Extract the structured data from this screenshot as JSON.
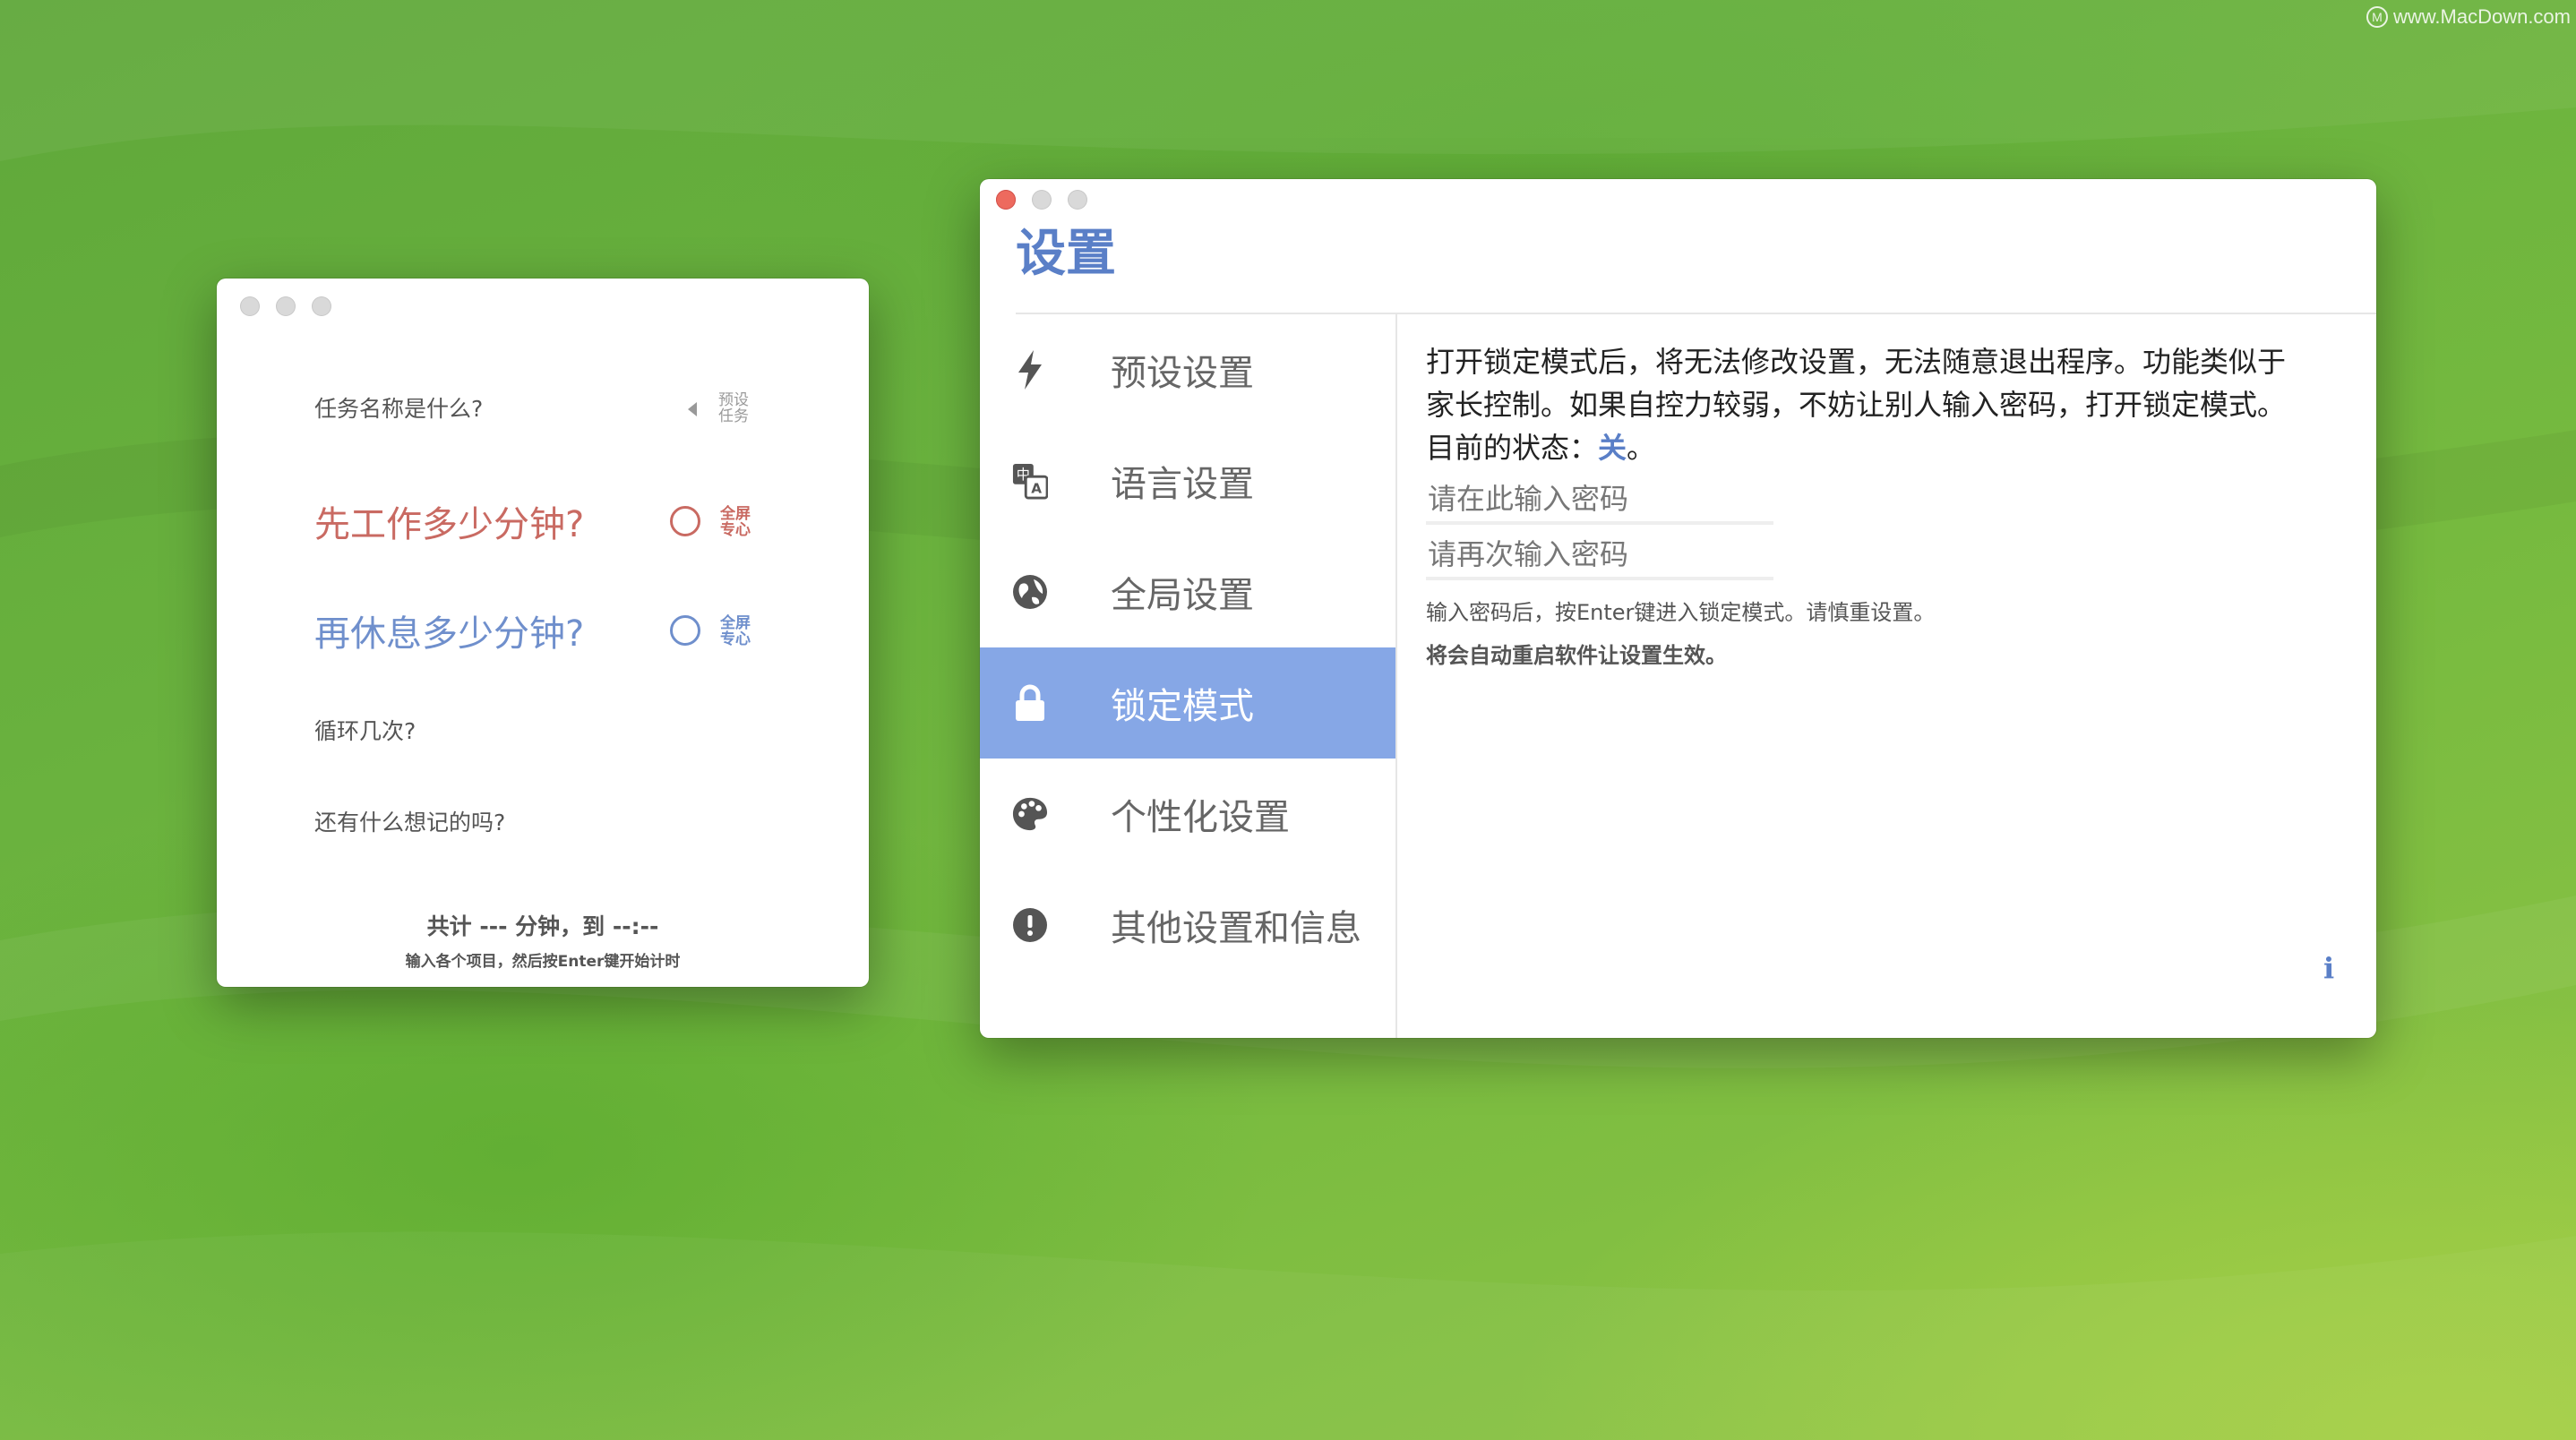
{
  "watermark": {
    "logo": "M",
    "text": "www.MacDown.com"
  },
  "timer_window": {
    "task_question": "任务名称是什么?",
    "preset_label_line1": "预设",
    "preset_label_line2": "任务",
    "work_question": "先工作多少分钟?",
    "rest_question": "再休息多少分钟?",
    "fullscreen_line1": "全屏",
    "fullscreen_line2": "专心",
    "loop_question": "循环几次?",
    "note_question": "还有什么想记的吗?",
    "total_text": "共计 --- 分钟，到 --:--",
    "hint": "输入各个项目，然后按Enter键开始计时",
    "work_color": "#c96a62",
    "rest_color": "#6f8fcc"
  },
  "settings_window": {
    "title": "设置",
    "nav": [
      {
        "label": "预设设置",
        "icon": "lightning-icon"
      },
      {
        "label": "语言设置",
        "icon": "translate-icon"
      },
      {
        "label": "全局设置",
        "icon": "globe-icon"
      },
      {
        "label": "锁定模式",
        "icon": "lock-icon",
        "active": true
      },
      {
        "label": "个性化设置",
        "icon": "palette-icon"
      },
      {
        "label": "其他设置和信息",
        "icon": "info-circle-icon"
      }
    ],
    "content": {
      "line1": "打开锁定模式后，将无法修改设置，无法随意退出程序。功能类似于",
      "line2": "家长控制。如果自控力较弱，不妨让别人输入密码，打开锁定模式。",
      "status_prefix": "目前的状态：",
      "status_value": "关",
      "status_suffix": "。",
      "password_placeholder": "请在此输入密码",
      "password_repeat_placeholder": "请再次输入密码",
      "hint1": "输入密码后，按Enter键进入锁定模式。请慎重设置。",
      "hint2": "将会自动重启软件让设置生效。",
      "info_button": "i"
    },
    "accent_color": "#5a7fc7",
    "active_bg": "#86a7e6"
  }
}
